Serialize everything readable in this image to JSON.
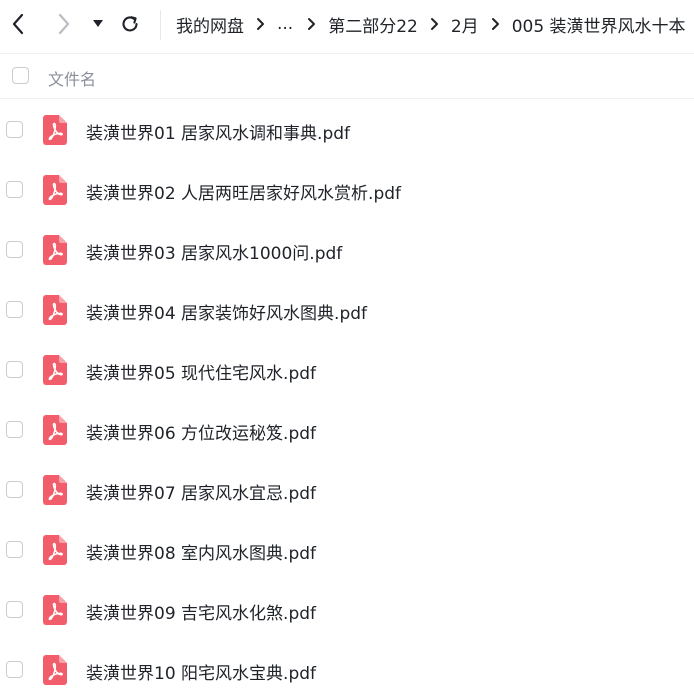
{
  "toolbar": {
    "back_icon": "chevron-left-icon",
    "forward_icon": "chevron-right-icon",
    "history_icon": "caret-down-icon",
    "refresh_icon": "refresh-icon"
  },
  "breadcrumb": {
    "items": [
      "我的网盘",
      "...",
      "第二部分22",
      "2月",
      "005 装潢世界风水十本"
    ],
    "separator_icon": "chevron-right-icon"
  },
  "list_header": {
    "column_name": "文件名"
  },
  "files": [
    {
      "name": "装潢世界01 居家风水调和事典.pdf",
      "icon": "pdf-icon"
    },
    {
      "name": "装潢世界02 人居两旺居家好风水赏析.pdf",
      "icon": "pdf-icon"
    },
    {
      "name": "装潢世界03 居家风水1000问.pdf",
      "icon": "pdf-icon"
    },
    {
      "name": "装潢世界04 居家装饰好风水图典.pdf",
      "icon": "pdf-icon"
    },
    {
      "name": "装潢世界05 现代住宅风水.pdf",
      "icon": "pdf-icon"
    },
    {
      "name": "装潢世界06 方位改运秘笈.pdf",
      "icon": "pdf-icon"
    },
    {
      "name": "装潢世界07 居家风水宜忌.pdf",
      "icon": "pdf-icon"
    },
    {
      "name": "装潢世界08 室内风水图典.pdf",
      "icon": "pdf-icon"
    },
    {
      "name": "装潢世界09 吉宅风水化煞.pdf",
      "icon": "pdf-icon"
    },
    {
      "name": "装潢世界10 阳宅风水宝典.pdf",
      "icon": "pdf-icon"
    }
  ],
  "colors": {
    "pdf_icon": "#f25d6b",
    "text": "#1f2329",
    "muted": "#8a8f99",
    "border": "#c9ccd1"
  }
}
